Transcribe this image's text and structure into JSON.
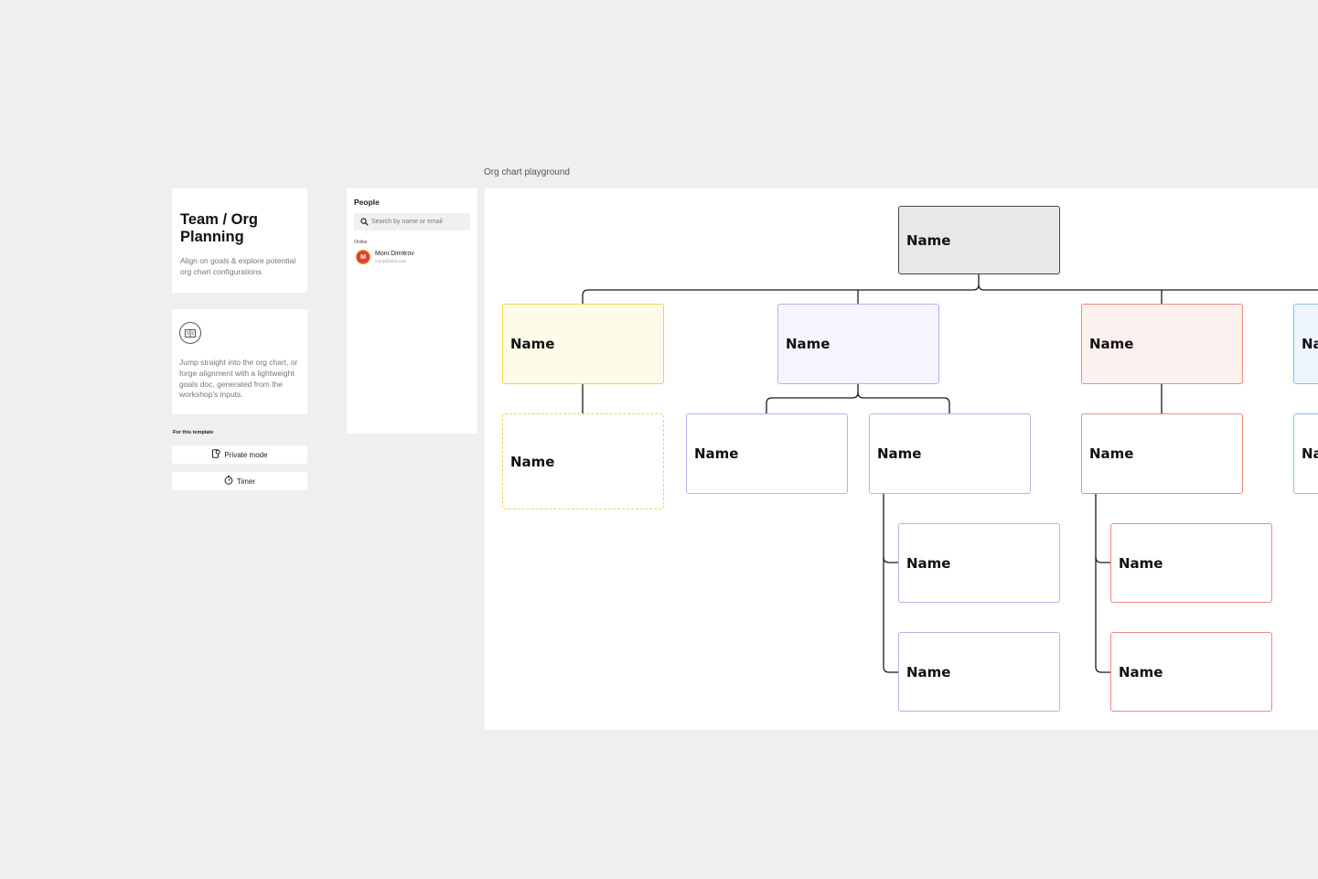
{
  "sidebar": {
    "info_card": {
      "title": "Team / Org Planning",
      "description": "Align on goals & explore potential org chart configurations"
    },
    "doc_card": {
      "icon": "book-open-icon",
      "description": "Jump straight into the org chart, or forge alignment with a lightweight goals doc, generated from the workshop's inputs."
    },
    "template_section_label": "For this template",
    "private_mode_label": "Private mode",
    "timer_label": "Timer"
  },
  "people_panel": {
    "title": "People",
    "search_placeholder": "Search by name or email",
    "online_label": "Online",
    "users": [
      {
        "initial": "M",
        "name": "Moni Dimitrov",
        "email": "mony@miro.com"
      }
    ]
  },
  "org_chart": {
    "frame_label": "Org chart playground",
    "nodes": {
      "root": "Name",
      "yellow_head": "Name",
      "yellow_child": "Name",
      "purple_head": "Name",
      "purple_child_1": "Name",
      "purple_child_2": "Name",
      "purple_sub_1": "Name",
      "purple_sub_2": "Name",
      "red_head": "Name",
      "red_child": "Name",
      "red_sub_1": "Name",
      "red_sub_2": "Name",
      "blue_head": "Na",
      "blue_child": "Na"
    },
    "colors": {
      "root": "#e8e8e8",
      "yellow": "#f2d44a",
      "purple": "#b8b2ee",
      "red": "#ec8b80",
      "blue": "#8ebcef"
    }
  }
}
